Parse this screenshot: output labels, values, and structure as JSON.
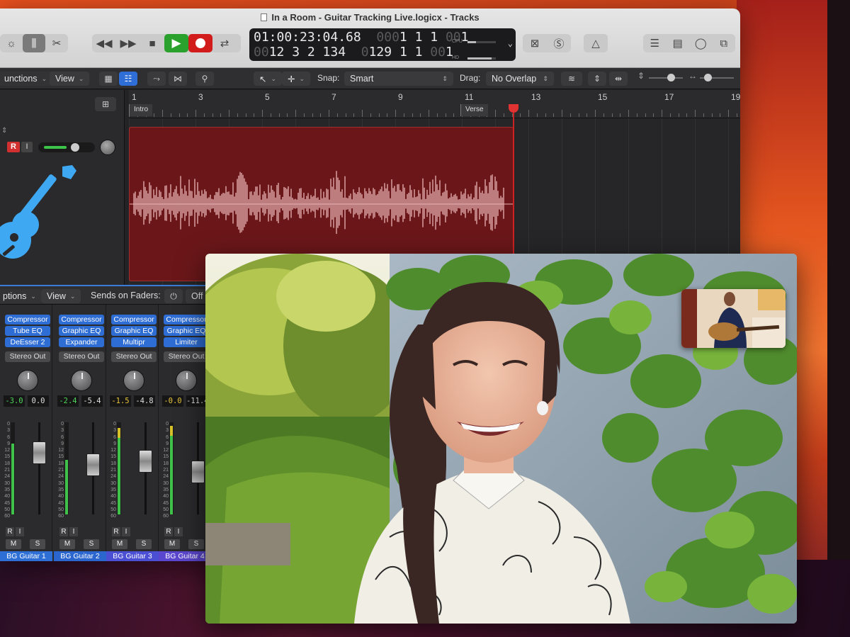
{
  "window": {
    "title": "In a Room - Guitar Tracking Live.logicx - Tracks"
  },
  "lcd": {
    "time": "01:00:23:04.68",
    "bars_top_dim": "000",
    "bars_top": "1  1  1",
    "bars_top_tail_dim": "00",
    "bars_top_tail": "1",
    "row2_dim": "00",
    "row2": "12  3  2  134",
    "row2b_dim": "0",
    "row2b": "129  1  1",
    "row2b_tail_dim": "00",
    "row2b_tail": "1",
    "cpu_label": "CPU",
    "hd_label": "HD"
  },
  "controlbar": {
    "functions": "unctions",
    "view": "View",
    "snap_label": "Snap:",
    "snap_value": "Smart",
    "drag_label": "Drag:",
    "drag_value": "No Overlap"
  },
  "ruler": {
    "bars": [
      "1",
      "3",
      "5",
      "7",
      "9",
      "11",
      "13",
      "15",
      "17",
      "19"
    ],
    "markers": [
      {
        "label": "Intro"
      },
      {
        "label": "Verse"
      }
    ]
  },
  "track": {
    "record": "R",
    "input": "I"
  },
  "mixer": {
    "options": "ptions",
    "view": "View",
    "sends_label": "Sends on Faders:",
    "sends_value": "Off",
    "strips": [
      {
        "plugins": [
          "Compressor",
          "Tube EQ",
          "DeEsser 2"
        ],
        "output": "Stereo Out",
        "vol": "-3.0",
        "peak": "0.0",
        "name": "BG Guitar 1",
        "color": "#2e6fd6",
        "fader": 0.72,
        "meter": 0.78,
        "peak_amber": false
      },
      {
        "plugins": [
          "Compressor",
          "Graphic EQ",
          "Expander"
        ],
        "output": "Stereo Out",
        "vol": "-2.4",
        "peak": "-5.4",
        "name": "BG Guitar 2",
        "color": "#2b66cf",
        "fader": 0.55,
        "meter": 0.6,
        "peak_amber": false
      },
      {
        "plugins": [
          "Compressor",
          "Graphic EQ",
          "Multipr"
        ],
        "output": "Stereo Out",
        "vol": "-1.5",
        "peak": "-4.8",
        "name": "BG Guitar 3",
        "color": "#4a4fd4",
        "fader": 0.6,
        "meter": 0.95,
        "peak_amber": true
      },
      {
        "plugins": [
          "Compressor",
          "Graphic EQ",
          "Limiter"
        ],
        "output": "Stereo Out",
        "vol": "-0.0",
        "peak": "-11.4",
        "name": "BG Guitar 4",
        "color": "#5a47cf",
        "fader": 0.45,
        "meter": 0.98,
        "peak_amber": true
      }
    ],
    "scale": [
      "0",
      "3",
      "6",
      "9",
      "12",
      "15",
      "18",
      "21",
      "24",
      "30",
      "35",
      "40",
      "45",
      "50",
      "60"
    ],
    "btn_r": "R",
    "btn_i": "I",
    "btn_m": "M",
    "btn_s": "S"
  },
  "colors": {
    "region": "#6b1719",
    "waveform": "#e9b4b4",
    "accent": "#2e6dd4",
    "play": "#2aa12c",
    "record": "#d21b1b"
  }
}
